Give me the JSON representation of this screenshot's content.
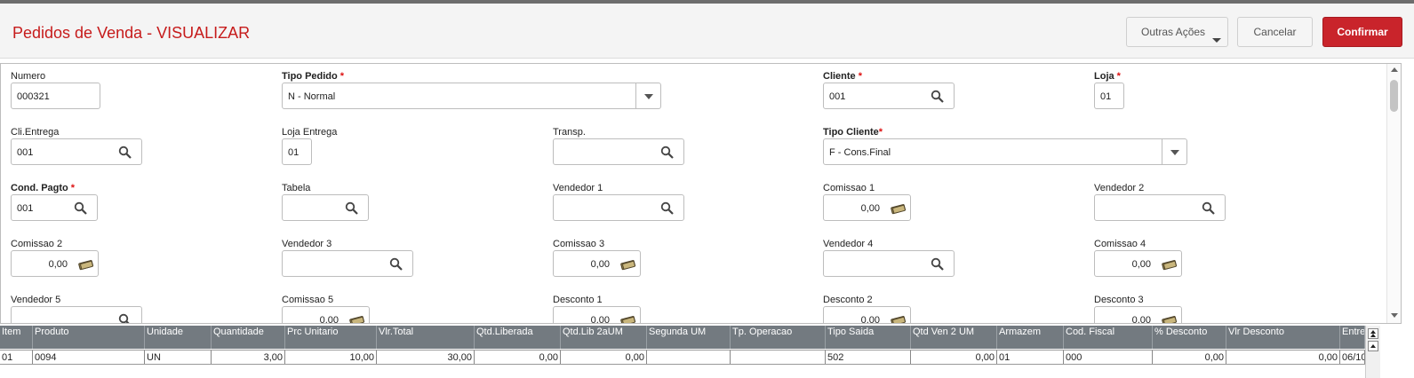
{
  "header": {
    "title": "Pedidos de Venda - VISUALIZAR",
    "other_actions_label": "Outras Ações",
    "cancel_label": "Cancelar",
    "confirm_label": "Confirmar"
  },
  "colors": {
    "title": "#c61b1b",
    "confirm": "#c9242b",
    "required": "#dd1111",
    "grid_header": "#737a80"
  },
  "form": {
    "numero": {
      "label": "Numero",
      "value": "000321"
    },
    "tipo_pedido": {
      "label": "Tipo Pedido",
      "required": "*",
      "value": "N - Normal"
    },
    "cliente": {
      "label": "Cliente",
      "required": "*",
      "value": "001"
    },
    "loja": {
      "label": "Loja",
      "required": "*",
      "value": "01"
    },
    "cli_entrega": {
      "label": "Cli.Entrega",
      "value": "001"
    },
    "loja_entrega": {
      "label": "Loja Entrega",
      "value": "01"
    },
    "transp": {
      "label": "Transp.",
      "value": ""
    },
    "tipo_cliente": {
      "label": "Tipo Cliente",
      "required": "*",
      "value": "F - Cons.Final"
    },
    "cond_pagto": {
      "label": "Cond. Pagto",
      "required": "*",
      "value": "001"
    },
    "tabela": {
      "label": "Tabela",
      "value": ""
    },
    "vendedor1": {
      "label": "Vendedor 1",
      "value": ""
    },
    "comissao1": {
      "label": "Comissao 1",
      "value": "0,00"
    },
    "vendedor2": {
      "label": "Vendedor 2",
      "value": ""
    },
    "comissao2": {
      "label": "Comissao 2",
      "value": "0,00"
    },
    "vendedor3": {
      "label": "Vendedor 3",
      "value": ""
    },
    "comissao3": {
      "label": "Comissao 3",
      "value": "0,00"
    },
    "vendedor4": {
      "label": "Vendedor 4",
      "value": ""
    },
    "comissao4": {
      "label": "Comissao 4",
      "value": "0,00"
    },
    "vendedor5": {
      "label": "Vendedor 5",
      "value": ""
    },
    "comissao5": {
      "label": "Comissao 5",
      "value": "0,00"
    },
    "desconto1": {
      "label": "Desconto 1",
      "value": "0,00"
    },
    "desconto2": {
      "label": "Desconto 2",
      "value": "0,00"
    },
    "desconto3": {
      "label": "Desconto 3",
      "value": "0,00"
    }
  },
  "grid": {
    "columns": [
      "Item",
      "Produto",
      "Unidade",
      "Quantidade",
      "Prc Unitario",
      "Vlr.Total",
      "Qtd.Liberada",
      "Qtd.Lib 2aUM",
      "Segunda UM",
      "Tp. Operacao",
      "Tipo Saida",
      "Qtd Ven 2 UM",
      "Armazem",
      "Cod. Fiscal",
      "% Desconto",
      "Vlr Desconto",
      "Entre"
    ],
    "rows": [
      [
        "01",
        "0094",
        "UN",
        "3,00",
        "10,00",
        "30,00",
        "0,00",
        "0,00",
        "",
        "",
        "502",
        "0,00",
        "01",
        "000",
        "0,00",
        "0,00",
        "06/10"
      ]
    ]
  },
  "icons": {
    "search": "search-icon",
    "money": "money-icon",
    "dropdown": "chevron-down-icon"
  }
}
